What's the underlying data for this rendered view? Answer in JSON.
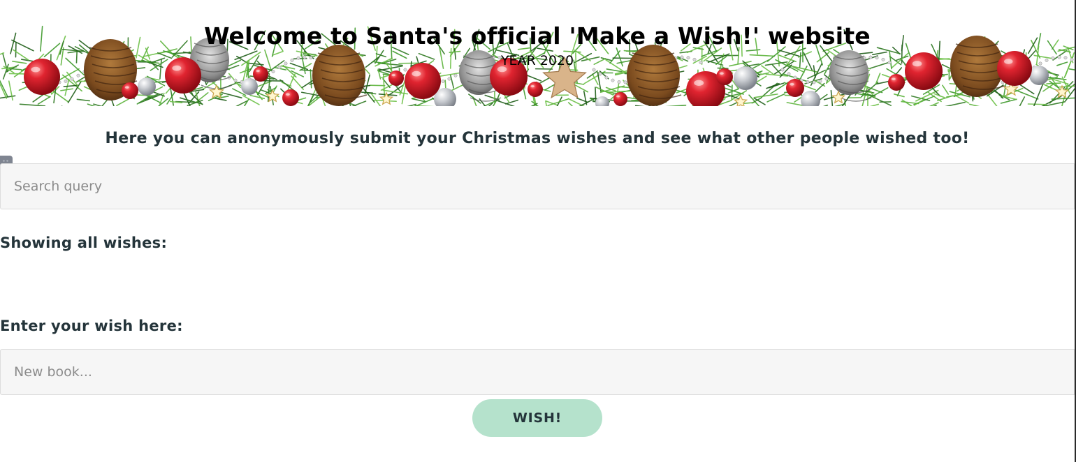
{
  "header": {
    "title": "Welcome to Santa's official 'Make a Wish!' website",
    "subtitle": "YEAR 2020"
  },
  "intro": "Here you can anonymously submit your Christmas wishes and see what other people wished too!",
  "search": {
    "placeholder": "Search query",
    "value": ""
  },
  "wishes_list": {
    "heading": "Showing all wishes:",
    "items": []
  },
  "wish_form": {
    "heading": "Enter your wish here:",
    "placeholder": "New book...",
    "value": "",
    "submit_label": "WISH!"
  },
  "colors": {
    "button_bg": "#b5e2cc",
    "text": "#24343a",
    "ornament_red": "#d81f2a",
    "ornament_silver": "#c8ccd2",
    "pine_green": "#2f7a22",
    "pinecone_brown": "#8a5a2b"
  },
  "icons": {
    "side_handle": "drag-handle-icon",
    "banner": "christmas-garland"
  }
}
